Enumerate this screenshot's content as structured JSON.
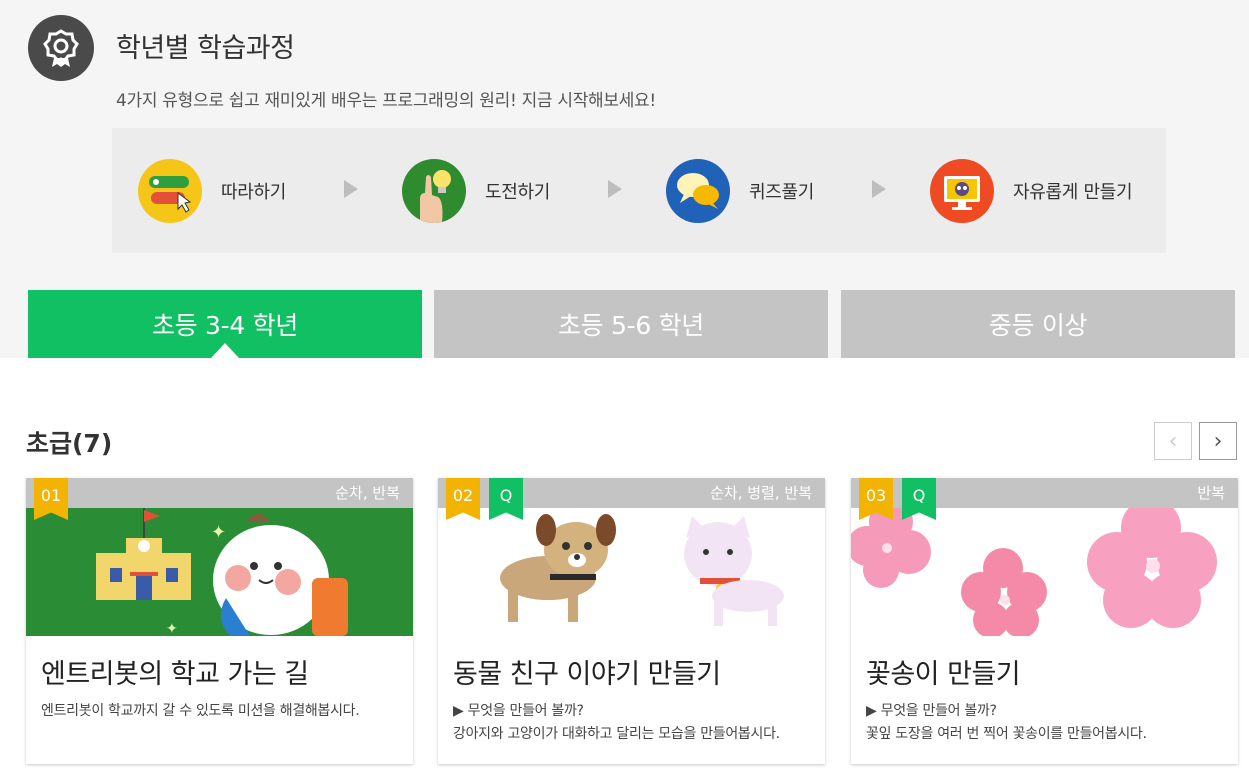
{
  "header": {
    "title": "학년별 학습과정",
    "subtitle": "4가지 유형으로 쉽고 재미있게 배우는 프로그래밍의 원리! 지금 시작해보세요!",
    "badge_icon": "award-ribbon-icon"
  },
  "steps": [
    {
      "label": "따라하기",
      "icon": "follow-along-icon",
      "color": "#f5c518"
    },
    {
      "label": "도전하기",
      "icon": "challenge-lightbulb-icon",
      "color": "#2e8b2e"
    },
    {
      "label": "퀴즈풀기",
      "icon": "quiz-speech-bubbles-icon",
      "color": "#1f62b8"
    },
    {
      "label": "자유롭게 만들기",
      "icon": "free-create-monitor-icon",
      "color": "#ef4b23"
    }
  ],
  "tabs": [
    {
      "label": "초등 3-4 학년",
      "active": true
    },
    {
      "label": "초등 5-6 학년",
      "active": false
    },
    {
      "label": "중등 이상",
      "active": false
    }
  ],
  "colors": {
    "accent": "#12c064",
    "inactive_tab": "#c4c4c4",
    "ribbon_num": "#f2b400",
    "ribbon_q": "#12c064"
  },
  "section": {
    "title": "초급(7)",
    "prev_icon": "chevron-left-icon",
    "next_icon": "chevron-right-icon",
    "prev_glyph": "‹",
    "next_glyph": "›"
  },
  "cards": [
    {
      "number": "01",
      "quiz": "",
      "tags": "순차, 반복",
      "title": "엔트리봇의 학교 가는 길",
      "desc_lines": [
        "엔트리봇이 학교까지 갈 수 있도록 미션을 해결해봅시다."
      ],
      "image": "school-robot-illustration"
    },
    {
      "number": "02",
      "quiz": "Q",
      "tags": "순차, 병렬, 반복",
      "title": "동물 친구 이야기 만들기",
      "desc_lines": [
        "▶ 무엇을 만들어 볼까?",
        "강아지와 고양이가 대화하고 달리는 모습을 만들어봅시다."
      ],
      "image": "dog-and-cat-illustration"
    },
    {
      "number": "03",
      "quiz": "Q",
      "tags": "반복",
      "title": "꽃송이 만들기",
      "desc_lines": [
        "▶ 무엇을 만들어 볼까?",
        "꽃잎 도장을 여러 번 찍어 꽃송이를 만들어봅시다."
      ],
      "image": "pink-flowers-illustration"
    }
  ]
}
